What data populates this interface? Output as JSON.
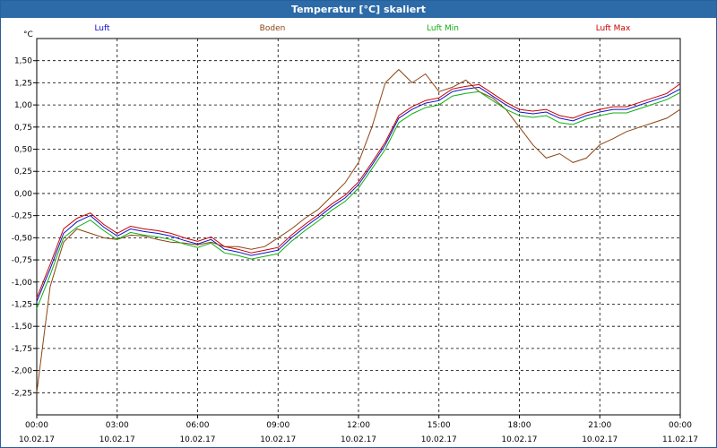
{
  "window": {
    "title": "Temperatur [°C] skaliert"
  },
  "chart_data": {
    "type": "line",
    "title": "Temperatur [°C] skaliert",
    "ylabel": "°C",
    "xlabel": "",
    "ylim": [
      -2.5,
      1.75
    ],
    "xlim": [
      0,
      24
    ],
    "grid": true,
    "legend_position": "top",
    "y_ticks": [
      -2.25,
      -2.0,
      -1.75,
      -1.5,
      -1.25,
      -1.0,
      -0.75,
      -0.5,
      -0.25,
      0.0,
      0.25,
      0.5,
      0.75,
      1.0,
      1.25,
      1.5
    ],
    "y_tick_labels": [
      "-2,25",
      "-2,00",
      "-1,75",
      "-1,50",
      "-1,25",
      "-1,00",
      "-0,75",
      "-0,50",
      "-0,25",
      "0,00",
      "0,25",
      "0,50",
      "0,75",
      "1,00",
      "1,25",
      "1,50"
    ],
    "x_ticks": [
      {
        "time": "00:00",
        "date": "10.02.17"
      },
      {
        "time": "03:00",
        "date": "10.02.17"
      },
      {
        "time": "06:00",
        "date": "10.02.17"
      },
      {
        "time": "09:00",
        "date": "10.02.17"
      },
      {
        "time": "12:00",
        "date": "10.02.17"
      },
      {
        "time": "15:00",
        "date": "10.02.17"
      },
      {
        "time": "18:00",
        "date": "10.02.17"
      },
      {
        "time": "21:00",
        "date": "10.02.17"
      },
      {
        "time": "00:00",
        "date": "11.02.17"
      }
    ],
    "x_hours": [
      0,
      0.5,
      1,
      1.5,
      2,
      2.5,
      3,
      3.5,
      4,
      4.5,
      5,
      5.5,
      6,
      6.5,
      7,
      7.5,
      8,
      8.5,
      9,
      9.5,
      10,
      10.5,
      11,
      11.5,
      12,
      12.5,
      13,
      13.5,
      14,
      14.5,
      15,
      15.5,
      16,
      16.5,
      17,
      17.5,
      18,
      18.5,
      19,
      19.5,
      20,
      20.5,
      21,
      21.5,
      22,
      22.5,
      23,
      23.5,
      24
    ],
    "series": [
      {
        "name": "Luft",
        "color": "#1010c8",
        "values": [
          -1.22,
          -0.85,
          -0.45,
          -0.32,
          -0.25,
          -0.38,
          -0.48,
          -0.4,
          -0.43,
          -0.45,
          -0.48,
          -0.53,
          -0.57,
          -0.52,
          -0.63,
          -0.66,
          -0.7,
          -0.67,
          -0.64,
          -0.5,
          -0.38,
          -0.27,
          -0.15,
          -0.05,
          0.1,
          0.32,
          0.55,
          0.85,
          0.95,
          1.02,
          1.05,
          1.15,
          1.18,
          1.2,
          1.1,
          1.0,
          0.92,
          0.9,
          0.92,
          0.85,
          0.82,
          0.88,
          0.92,
          0.95,
          0.95,
          1.0,
          1.05,
          1.1,
          1.18
        ]
      },
      {
        "name": "Boden",
        "color": "#8b4513",
        "values": [
          -2.25,
          -1.05,
          -0.55,
          -0.4,
          -0.45,
          -0.5,
          -0.52,
          -0.47,
          -0.48,
          -0.52,
          -0.55,
          -0.56,
          -0.58,
          -0.55,
          -0.6,
          -0.6,
          -0.63,
          -0.6,
          -0.5,
          -0.4,
          -0.28,
          -0.18,
          -0.03,
          0.12,
          0.35,
          0.75,
          1.25,
          1.4,
          1.25,
          1.35,
          1.15,
          1.2,
          1.28,
          1.15,
          1.08,
          0.95,
          0.75,
          0.55,
          0.4,
          0.45,
          0.35,
          0.4,
          0.55,
          0.62,
          0.7,
          0.75,
          0.8,
          0.85,
          0.95
        ]
      },
      {
        "name": "Luft Min",
        "color": "#10b010",
        "values": [
          -1.3,
          -0.92,
          -0.5,
          -0.38,
          -0.3,
          -0.42,
          -0.52,
          -0.44,
          -0.47,
          -0.49,
          -0.52,
          -0.57,
          -0.61,
          -0.56,
          -0.67,
          -0.7,
          -0.74,
          -0.71,
          -0.68,
          -0.54,
          -0.42,
          -0.31,
          -0.19,
          -0.09,
          0.06,
          0.28,
          0.5,
          0.8,
          0.9,
          0.97,
          1.0,
          1.1,
          1.13,
          1.15,
          1.05,
          0.95,
          0.88,
          0.86,
          0.88,
          0.8,
          0.78,
          0.84,
          0.88,
          0.91,
          0.91,
          0.96,
          1.01,
          1.06,
          1.14
        ]
      },
      {
        "name": "Luft Max",
        "color": "#c80000",
        "values": [
          -1.18,
          -0.8,
          -0.4,
          -0.28,
          -0.22,
          -0.35,
          -0.45,
          -0.37,
          -0.4,
          -0.42,
          -0.45,
          -0.5,
          -0.54,
          -0.49,
          -0.6,
          -0.63,
          -0.67,
          -0.64,
          -0.61,
          -0.47,
          -0.35,
          -0.24,
          -0.12,
          -0.02,
          0.13,
          0.35,
          0.58,
          0.88,
          0.98,
          1.05,
          1.08,
          1.18,
          1.21,
          1.23,
          1.13,
          1.03,
          0.95,
          0.93,
          0.95,
          0.88,
          0.85,
          0.91,
          0.95,
          0.98,
          0.98,
          1.03,
          1.08,
          1.13,
          1.24
        ]
      }
    ]
  }
}
